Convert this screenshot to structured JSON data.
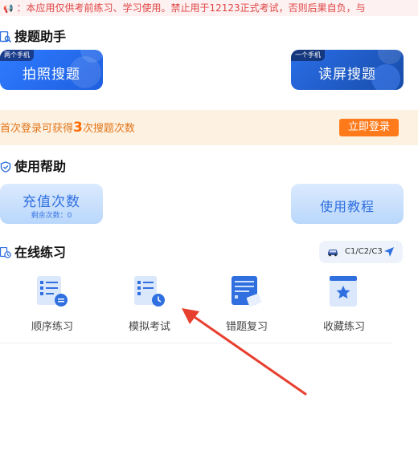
{
  "notice": {
    "text": "：本应用仅供考前练习、学习使用。禁止用于12123正式考试，否则后果自负，与"
  },
  "search_section": {
    "title": "搜题助手",
    "photo_card": {
      "tag": "两个手机",
      "label": "拍照搜题"
    },
    "screen_card": {
      "tag": "一个手机",
      "label": "读屏搜题"
    }
  },
  "promo": {
    "prefix": "首次登录可获得",
    "count": "3",
    "suffix": "次搜题次数",
    "button": "立即登录"
  },
  "help_section": {
    "title": "使用帮助",
    "recharge_card": {
      "label": "充值次数",
      "sub": "剩余次数：0"
    },
    "tutorial_card": {
      "label": "使用教程"
    }
  },
  "practice_section": {
    "title": "在线练习",
    "license_types": "C1/C2/C3",
    "items": [
      {
        "label": "顺序练习"
      },
      {
        "label": "模拟考试"
      },
      {
        "label": "错题复习"
      },
      {
        "label": "收藏练习"
      }
    ]
  },
  "colors": {
    "primary": "#2f7bff",
    "accent_orange": "#ff7a1a",
    "notice_red": "#e04646",
    "annotation_red": "#e8402f"
  }
}
